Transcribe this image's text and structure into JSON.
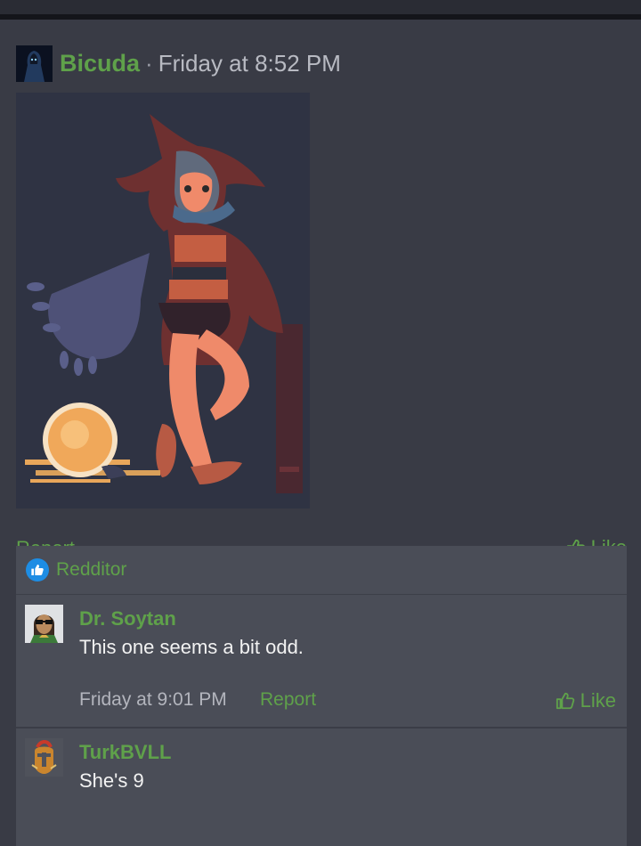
{
  "post": {
    "author": "Bicuda",
    "separator": "·",
    "time": "Friday at 8:52 PM",
    "report_label": "Report",
    "like_label": "Like"
  },
  "reactions": {
    "icon": "thumbs-up-icon",
    "name": "Redditor"
  },
  "comments": [
    {
      "author": "Dr. Soytan",
      "text": "This one seems a bit odd.",
      "time": "Friday at 9:01 PM",
      "report_label": "Report",
      "like_label": "Like"
    },
    {
      "author": "TurkBVLL",
      "text": "She's 9"
    }
  ],
  "colors": {
    "background": "#393b45",
    "panel": "#4a4d57",
    "accent_green": "#5fa14a",
    "reaction_blue": "#1d8de4"
  }
}
